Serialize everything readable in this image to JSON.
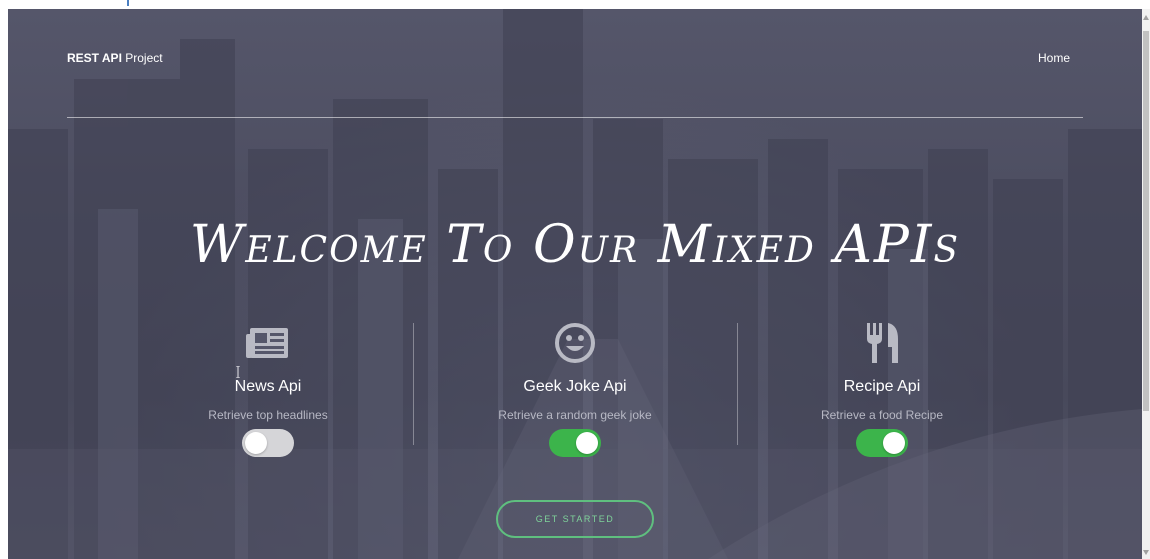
{
  "nav": {
    "brand_bold": "REST API",
    "brand_rest": "Project",
    "home": "Home"
  },
  "hero": {
    "title": "Welcome To Our Mixed APIs"
  },
  "features": [
    {
      "title": "News Api",
      "subtitle": "Retrieve top headlines",
      "enabled": false,
      "icon": "newspaper-icon"
    },
    {
      "title": "Geek Joke Api",
      "subtitle": "Retrieve a random geek joke",
      "enabled": true,
      "icon": "smiley-icon"
    },
    {
      "title": "Recipe Api",
      "subtitle": "Retrieve a food Recipe",
      "enabled": true,
      "icon": "utensils-icon"
    }
  ],
  "cta": {
    "label": "GET STARTED"
  },
  "colors": {
    "accent": "#3cb44b",
    "cta_border": "#5fbf7f",
    "toggle_off": "#d5d5d8",
    "overlay": "#4c4d60"
  }
}
